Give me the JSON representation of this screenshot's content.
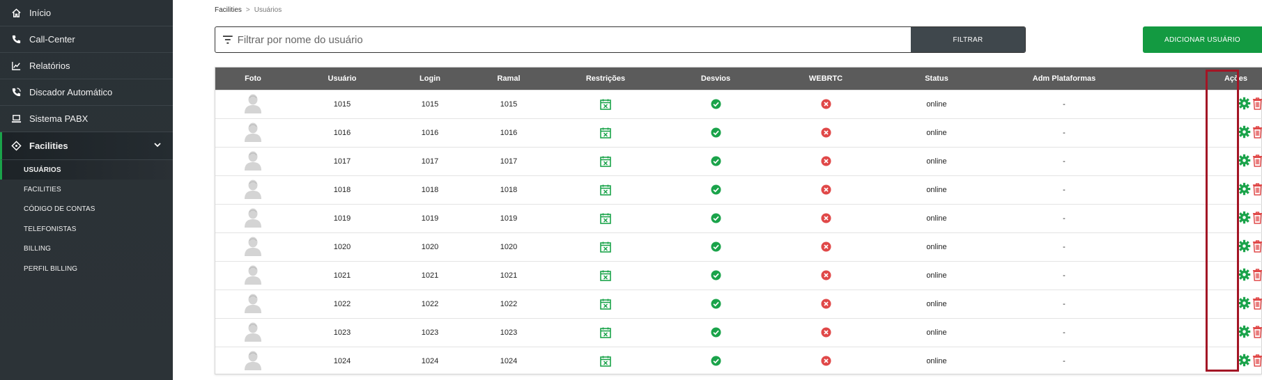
{
  "sidebar": {
    "items": [
      {
        "label": "Início",
        "icon": "home-icon"
      },
      {
        "label": "Call-Center",
        "icon": "phone-icon"
      },
      {
        "label": "Relatórios",
        "icon": "chart-line-icon"
      },
      {
        "label": "Discador Automático",
        "icon": "phone-dialer-icon"
      },
      {
        "label": "Sistema PABX",
        "icon": "laptop-icon"
      },
      {
        "label": "Facilities",
        "icon": "diamond-icon"
      }
    ],
    "sub_items": [
      "USUÁRIOS",
      "FACILITIES",
      "CÓDIGO DE CONTAS",
      "TELEFONISTAS",
      "BILLING",
      "PERFIL BILLING"
    ]
  },
  "breadcrumb": {
    "parent": "Facilities",
    "separator": ">",
    "current": "Usuários"
  },
  "filter": {
    "placeholder": "Filtrar por nome do usuário",
    "button": "FILTRAR"
  },
  "add_button": "ADICIONAR USUÁRIO",
  "table": {
    "headers": [
      "Foto",
      "Usuário",
      "Login",
      "Ramal",
      "Restrições",
      "Desvios",
      "WEBRTC",
      "Status",
      "Adm Plataformas",
      "Ações"
    ],
    "rows": [
      {
        "usuario": "1015",
        "login": "1015",
        "ramal": "1015",
        "status": "online",
        "adm": "-"
      },
      {
        "usuario": "1016",
        "login": "1016",
        "ramal": "1016",
        "status": "online",
        "adm": "-"
      },
      {
        "usuario": "1017",
        "login": "1017",
        "ramal": "1017",
        "status": "online",
        "adm": "-"
      },
      {
        "usuario": "1018",
        "login": "1018",
        "ramal": "1018",
        "status": "online",
        "adm": "-"
      },
      {
        "usuario": "1019",
        "login": "1019",
        "ramal": "1019",
        "status": "online",
        "adm": "-"
      },
      {
        "usuario": "1020",
        "login": "1020",
        "ramal": "1020",
        "status": "online",
        "adm": "-"
      },
      {
        "usuario": "1021",
        "login": "1021",
        "ramal": "1021",
        "status": "online",
        "adm": "-"
      },
      {
        "usuario": "1022",
        "login": "1022",
        "ramal": "1022",
        "status": "online",
        "adm": "-"
      },
      {
        "usuario": "1023",
        "login": "1023",
        "ramal": "1023",
        "status": "online",
        "adm": "-"
      },
      {
        "usuario": "1024",
        "login": "1024",
        "ramal": "1024",
        "status": "online",
        "adm": "-"
      }
    ]
  },
  "colors": {
    "accent_green": "#139a41",
    "danger_red": "#e04848",
    "highlight": "#a31525",
    "header_gray": "#5b5b5b"
  }
}
